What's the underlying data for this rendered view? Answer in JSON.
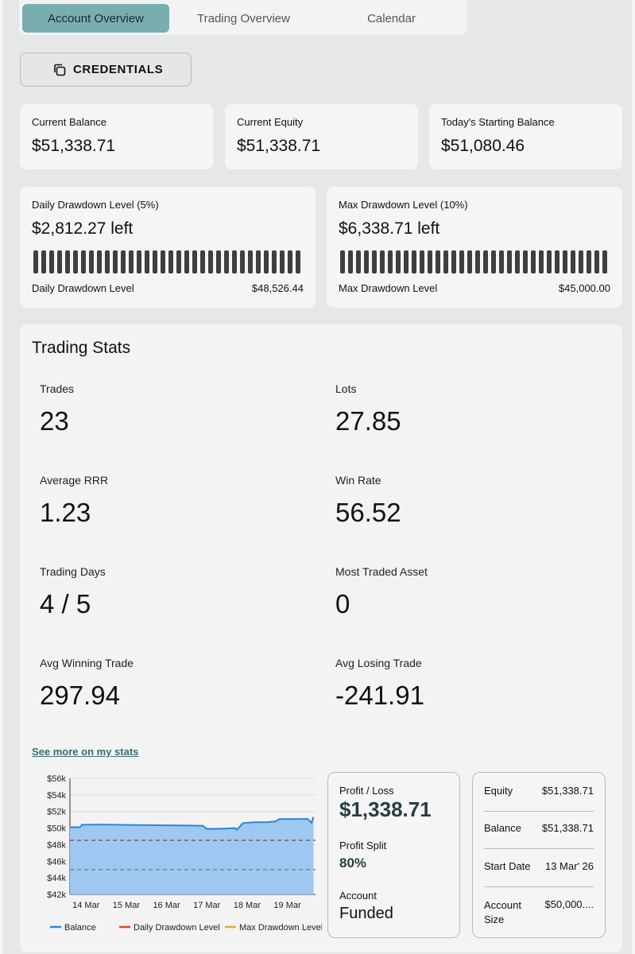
{
  "tabs": [
    {
      "label": "Account Overview",
      "active": true
    },
    {
      "label": "Trading Overview",
      "active": false
    },
    {
      "label": "Calendar",
      "active": false
    }
  ],
  "credentials_label": "CREDENTIALS",
  "balance_cards": [
    {
      "label": "Current Balance",
      "value": "$51,338.71"
    },
    {
      "label": "Current Equity",
      "value": "$51,338.71"
    },
    {
      "label": "Today's Starting Balance",
      "value": "$51,080.46"
    }
  ],
  "drawdown": {
    "daily": {
      "title": "Daily Drawdown Level (5%)",
      "left": "$2,812.27 left",
      "level_label": "Daily Drawdown Level",
      "level_value": "$48,526.44",
      "remaining_fraction": 1.0
    },
    "max": {
      "title": "Max Drawdown Level (10%)",
      "left": "$6,338.71 left",
      "level_label": "Max Drawdown Level",
      "level_value": "$45,000.00",
      "remaining_fraction": 1.0
    }
  },
  "stats": {
    "title": "Trading Stats",
    "items": [
      {
        "label": "Trades",
        "value": "23"
      },
      {
        "label": "Lots",
        "value": "27.85"
      },
      {
        "label": "Average RRR",
        "value": "1.23"
      },
      {
        "label": "Win Rate",
        "value": "56.52"
      },
      {
        "label": "Trading Days",
        "value": "4 / 5"
      },
      {
        "label": "Most Traded Asset",
        "value": "0"
      },
      {
        "label": "Avg Winning Trade",
        "value": "297.94"
      },
      {
        "label": "Avg Losing Trade",
        "value": "-241.91"
      }
    ],
    "see_more": "See more on my stats"
  },
  "chart_data": {
    "type": "area",
    "x_ticks": [
      "14 Mar",
      "15 Mar",
      "16 Mar",
      "17 Mar",
      "18 Mar",
      "19 Mar"
    ],
    "y_ticks": [
      "$56k",
      "$54k",
      "$52k",
      "$50k",
      "$48k",
      "$46k",
      "$44k",
      "$42k"
    ],
    "ylim": [
      42000,
      56000
    ],
    "series": [
      {
        "name": "Balance",
        "color": "#2b86d6",
        "points": [
          [
            13.6,
            50100
          ],
          [
            13.85,
            50100
          ],
          [
            13.9,
            50400
          ],
          [
            14.0,
            50400
          ],
          [
            14.5,
            50420
          ],
          [
            15.0,
            50380
          ],
          [
            15.5,
            50350
          ],
          [
            16.0,
            50330
          ],
          [
            16.5,
            50300
          ],
          [
            16.9,
            50280
          ],
          [
            17.0,
            49900
          ],
          [
            17.2,
            49900
          ],
          [
            17.5,
            49950
          ],
          [
            17.7,
            50000
          ],
          [
            17.75,
            49800
          ],
          [
            17.9,
            50600
          ],
          [
            18.2,
            50700
          ],
          [
            18.5,
            50700
          ],
          [
            18.6,
            50760
          ],
          [
            18.7,
            50780
          ],
          [
            18.8,
            51080
          ],
          [
            19.2,
            51080
          ],
          [
            19.5,
            51100
          ],
          [
            19.6,
            50650
          ],
          [
            19.65,
            51338.71
          ]
        ]
      },
      {
        "name": "Daily Drawdown Level",
        "color": "#d84b2a",
        "constant": 48526.44
      },
      {
        "name": "Max Drawdown Level",
        "color": "#e8a92b",
        "constant": 45000
      }
    ],
    "xlim": [
      13.6,
      19.7
    ],
    "legend_placement": "bottom"
  },
  "profit": {
    "pl_label": "Profit / Loss",
    "pl_value": "$1,338.71",
    "split_label": "Profit Split",
    "split_value": "80%",
    "account_label": "Account",
    "account_value": "Funded"
  },
  "account_info": [
    {
      "label": "Equity",
      "value": "$51,338.71"
    },
    {
      "label": "Balance",
      "value": "$51,338.71"
    },
    {
      "label": "Start Date",
      "value": "13 Mar' 26"
    },
    {
      "label": "Account Size",
      "value": "$50,000...."
    }
  ]
}
